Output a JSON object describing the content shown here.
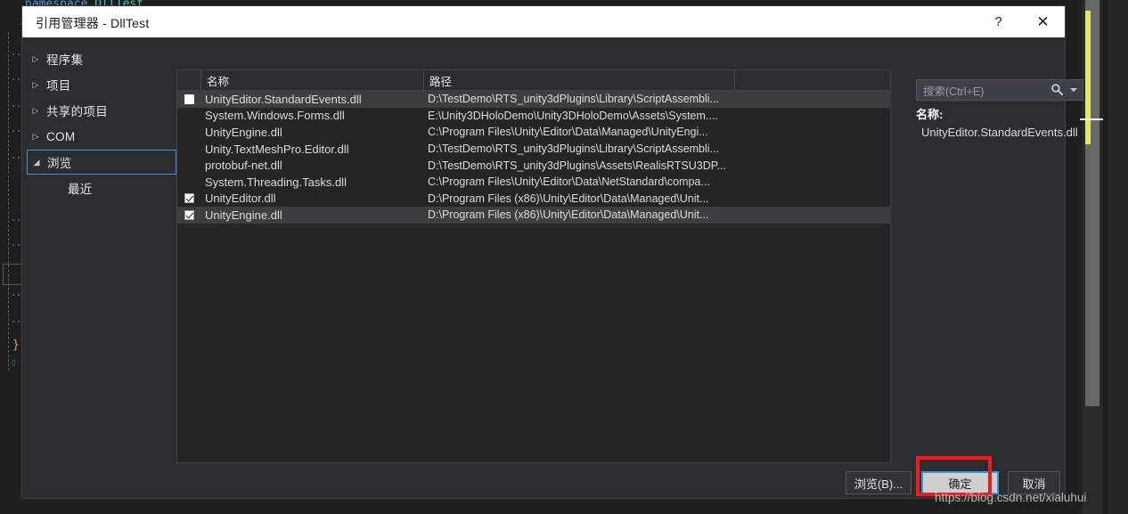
{
  "editor_background": {
    "namespace_line": "namespace DllTest",
    "open_brace": "{",
    "close_brace": "}"
  },
  "dialog": {
    "title": "引用管理器 - DllTest",
    "help_button": "?",
    "close_button": "✕",
    "sidebar": {
      "items": [
        {
          "label": "程序集",
          "arrow": "▷",
          "selected": false,
          "child": false
        },
        {
          "label": "项目",
          "arrow": "▷",
          "selected": false,
          "child": false
        },
        {
          "label": "共享的项目",
          "arrow": "▷",
          "selected": false,
          "child": false
        },
        {
          "label": "COM",
          "arrow": "▷",
          "selected": false,
          "child": false
        },
        {
          "label": "浏览",
          "arrow": "◢",
          "selected": true,
          "child": false
        },
        {
          "label": "最近",
          "arrow": "",
          "selected": false,
          "child": true
        }
      ]
    },
    "list": {
      "columns": [
        "",
        "名称",
        "路径",
        ""
      ],
      "rows": [
        {
          "name": "UnityEditor.StandardEvents.dll",
          "path": "D:\\TestDemo\\RTS_unity3dPlugins\\Library\\ScriptAssembli...",
          "checked": false,
          "hover": true
        },
        {
          "name": "System.Windows.Forms.dll",
          "path": "E:\\Unity3DHoloDemo\\Unity3DHoloDemo\\Assets\\System....",
          "checked": false,
          "hover": false
        },
        {
          "name": "UnityEngine.dll",
          "path": "C:\\Program Files\\Unity\\Editor\\Data\\Managed\\UnityEngi...",
          "checked": false,
          "hover": false
        },
        {
          "name": "Unity.TextMeshPro.Editor.dll",
          "path": "D:\\TestDemo\\RTS_unity3dPlugins\\Library\\ScriptAssembli...",
          "checked": false,
          "hover": false
        },
        {
          "name": "protobuf-net.dll",
          "path": "D:\\TestDemo\\RTS_unity3dPlugins\\Assets\\RealisRTSU3DP...",
          "checked": false,
          "hover": false
        },
        {
          "name": "System.Threading.Tasks.dll",
          "path": "C:\\Program Files\\Unity\\Editor\\Data\\NetStandard\\compa...",
          "checked": false,
          "hover": false
        },
        {
          "name": "UnityEditor.dll",
          "path": "D:\\Program Files (x86)\\Unity\\Editor\\Data\\Managed\\Unit...",
          "checked": true,
          "hover": false
        },
        {
          "name": "UnityEngine.dll",
          "path": "D:\\Program Files (x86)\\Unity\\Editor\\Data\\Managed\\Unit...",
          "checked": true,
          "hover": true
        }
      ]
    },
    "search": {
      "placeholder": "搜索(Ctrl+E)",
      "value": ""
    },
    "details": {
      "label": "名称:",
      "value": "UnityEditor.StandardEvents.dll"
    },
    "buttons": {
      "browse": "浏览(B)...",
      "ok": "确定",
      "cancel": "取消"
    }
  },
  "watermark": "https://blog.csdn.net/xialuhui",
  "colors": {
    "accent_blue": "#3a96dd",
    "annotation_red": "#ec1c24",
    "dialog_bg": "#2d2d30",
    "list_bg": "#252526",
    "titlebar_bg": "#ffffff",
    "change_bar_yellow": "#e2e86b"
  }
}
